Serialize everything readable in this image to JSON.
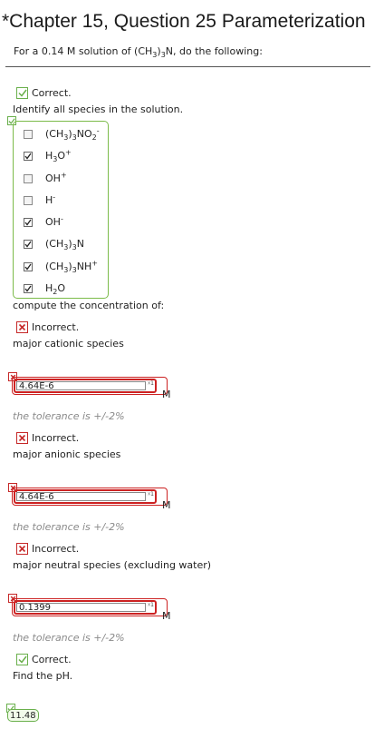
{
  "header": {
    "title": "*Chapter 15, Question 25 Parameterization",
    "intro_prefix": "For a 0.14 M solution of (CH",
    "intro_sub1": "3",
    "intro_mid": ")",
    "intro_sub2": "3",
    "intro_suffix": "N, do the following:"
  },
  "feedback": {
    "correct": "Correct.",
    "incorrect": "Incorrect."
  },
  "q1": {
    "prompt": "Identify all species in the solution.",
    "options": [
      {
        "checked": false
      },
      {
        "checked": true
      },
      {
        "checked": false
      },
      {
        "checked": false
      },
      {
        "checked": true
      },
      {
        "checked": true
      },
      {
        "checked": true
      },
      {
        "checked": true
      }
    ]
  },
  "q2": {
    "intro": "compute the concentration of:",
    "cation_label": "major cationic species",
    "cation_value": "4.64E-6",
    "anion_label": "major anionic species",
    "anion_value": "4.64E-6",
    "neutral_label": "major neutral species (excluding water)",
    "neutral_value": "0.1399",
    "unit": "M",
    "sigfig_badge": "☓1",
    "tolerance": "the tolerance is +/-2%"
  },
  "q3": {
    "prompt": "Find the pH.",
    "answer": "11.48"
  },
  "colors": {
    "correct_green": "#6ab04c",
    "incorrect_red": "#cc2222"
  }
}
